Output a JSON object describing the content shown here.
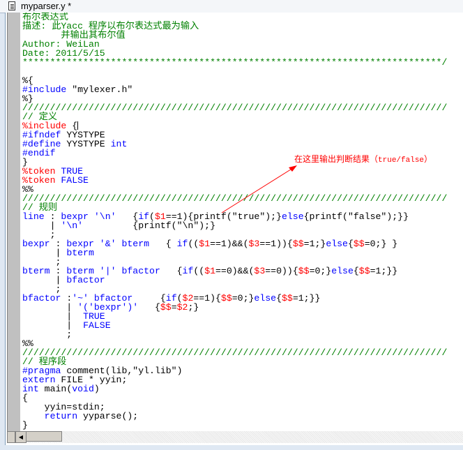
{
  "window": {
    "title": "myparser.y *"
  },
  "colors": {
    "comment": "#008000",
    "keyword": "#0000ff",
    "directive": "#ff0000",
    "text": "#000000"
  },
  "annotation": {
    "text": "在这里输出判断结果（",
    "text_en": "true/false",
    "text_end": "）",
    "color": "#ff0000"
  },
  "code_lines": [
    [
      [
        "g",
        "布尔表达式"
      ]
    ],
    [
      [
        "g",
        "描述: 此Yacc 程序以布尔表达式最为输入"
      ]
    ],
    [
      [
        "g",
        "       并输出其布尔值"
      ]
    ],
    [
      [
        "g",
        "Author: WeiLan"
      ]
    ],
    [
      [
        "g",
        "Date: 2011/5/15"
      ]
    ],
    [
      [
        "g",
        "****************************************************************************/"
      ]
    ],
    [
      [
        "k",
        " "
      ]
    ],
    [
      [
        "k",
        "%{"
      ]
    ],
    [
      [
        "b",
        "#include"
      ],
      [
        "k",
        " \"mylexer.h\""
      ]
    ],
    [
      [
        "k",
        "%}"
      ]
    ],
    [
      [
        "g",
        "/////////////////////////////////////////////////////////////////////////////"
      ]
    ],
    [
      [
        "g",
        "// 定义"
      ]
    ],
    [
      [
        "r",
        "%include"
      ],
      [
        "k",
        " {"
      ],
      [
        "cursor",
        ""
      ]
    ],
    [
      [
        "b",
        "#ifndef"
      ],
      [
        "k",
        " YYSTYPE"
      ]
    ],
    [
      [
        "b",
        "#define"
      ],
      [
        "k",
        " YYSTYPE "
      ],
      [
        "b",
        "int"
      ]
    ],
    [
      [
        "b",
        "#endif"
      ]
    ],
    [
      [
        "k",
        "}"
      ]
    ],
    [
      [
        "r",
        "%token"
      ],
      [
        "b",
        " TRUE"
      ]
    ],
    [
      [
        "r",
        "%token"
      ],
      [
        "b",
        " FALSE"
      ]
    ],
    [
      [
        "k",
        "%%"
      ]
    ],
    [
      [
        "g",
        "/////////////////////////////////////////////////////////////////////////////"
      ]
    ],
    [
      [
        "g",
        "// 规则"
      ]
    ],
    [
      [
        "b",
        "line"
      ],
      [
        "k",
        " : "
      ],
      [
        "b",
        "bexpr '\\n'"
      ],
      [
        "k",
        "   {"
      ],
      [
        "b",
        "if"
      ],
      [
        "k",
        "("
      ],
      [
        "r",
        "$1"
      ],
      [
        "k",
        "==1){printf(\"true\");}"
      ],
      [
        "b",
        "else"
      ],
      [
        "k",
        "{printf(\"false\");}}"
      ]
    ],
    [
      [
        "k",
        "     | "
      ],
      [
        "b",
        "'\\n'"
      ],
      [
        "k",
        "         {printf(\"\\n\");}"
      ]
    ],
    [
      [
        "k",
        "     ;"
      ]
    ],
    [
      [
        "b",
        "bexpr"
      ],
      [
        "k",
        " : "
      ],
      [
        "b",
        "bexpr '&' bterm"
      ],
      [
        "k",
        "   { "
      ],
      [
        "b",
        "if"
      ],
      [
        "k",
        "(("
      ],
      [
        "r",
        "$1"
      ],
      [
        "k",
        "==1)&&("
      ],
      [
        "r",
        "$3"
      ],
      [
        "k",
        "==1)){"
      ],
      [
        "r",
        "$$"
      ],
      [
        "k",
        "=1;}"
      ],
      [
        "b",
        "else"
      ],
      [
        "k",
        "{"
      ],
      [
        "r",
        "$$"
      ],
      [
        "k",
        "=0;} }"
      ]
    ],
    [
      [
        "k",
        "      | "
      ],
      [
        "b",
        "bterm"
      ]
    ],
    [
      [
        "k",
        "      ;"
      ]
    ],
    [
      [
        "b",
        "bterm"
      ],
      [
        "k",
        " : "
      ],
      [
        "b",
        "bterm '|' bfactor"
      ],
      [
        "k",
        "   {"
      ],
      [
        "b",
        "if"
      ],
      [
        "k",
        "(("
      ],
      [
        "r",
        "$1"
      ],
      [
        "k",
        "==0)&&("
      ],
      [
        "r",
        "$3"
      ],
      [
        "k",
        "==0)){"
      ],
      [
        "r",
        "$$"
      ],
      [
        "k",
        "=0;}"
      ],
      [
        "b",
        "else"
      ],
      [
        "k",
        "{"
      ],
      [
        "r",
        "$$"
      ],
      [
        "k",
        "=1;}}"
      ]
    ],
    [
      [
        "k",
        "      | "
      ],
      [
        "b",
        "bfactor"
      ]
    ],
    [
      [
        "k",
        "      ;"
      ]
    ],
    [
      [
        "b",
        "bfactor"
      ],
      [
        "k",
        " :"
      ],
      [
        "b",
        "'~' bfactor"
      ],
      [
        "k",
        "     {"
      ],
      [
        "b",
        "if"
      ],
      [
        "k",
        "("
      ],
      [
        "r",
        "$2"
      ],
      [
        "k",
        "==1){"
      ],
      [
        "r",
        "$$"
      ],
      [
        "k",
        "=0;}"
      ],
      [
        "b",
        "else"
      ],
      [
        "k",
        "{"
      ],
      [
        "r",
        "$$"
      ],
      [
        "k",
        "=1;}}"
      ]
    ],
    [
      [
        "k",
        "        | "
      ],
      [
        "b",
        "'('bexpr')'"
      ],
      [
        "k",
        "   {"
      ],
      [
        "r",
        "$$"
      ],
      [
        "k",
        "="
      ],
      [
        "r",
        "$2"
      ],
      [
        "k",
        ";}"
      ]
    ],
    [
      [
        "k",
        "        |  "
      ],
      [
        "b",
        "TRUE"
      ]
    ],
    [
      [
        "k",
        "        |  "
      ],
      [
        "b",
        "FALSE"
      ]
    ],
    [
      [
        "k",
        "        ;"
      ]
    ],
    [
      [
        "k",
        "%%"
      ]
    ],
    [
      [
        "g",
        "/////////////////////////////////////////////////////////////////////////////"
      ]
    ],
    [
      [
        "g",
        "// 程序段"
      ]
    ],
    [
      [
        "b",
        "#pragma"
      ],
      [
        "k",
        " comment(lib,\"yl.lib\")"
      ]
    ],
    [
      [
        "b",
        "extern"
      ],
      [
        "k",
        " FILE * yyin;"
      ]
    ],
    [
      [
        "b",
        "int"
      ],
      [
        "k",
        " main("
      ],
      [
        "b",
        "void"
      ],
      [
        "k",
        ")"
      ]
    ],
    [
      [
        "k",
        "{"
      ]
    ],
    [
      [
        "k",
        "    yyin=stdin;"
      ]
    ],
    [
      [
        "k",
        "    "
      ],
      [
        "b",
        "return"
      ],
      [
        "k",
        " yyparse();"
      ]
    ],
    [
      [
        "k",
        "}"
      ]
    ]
  ]
}
